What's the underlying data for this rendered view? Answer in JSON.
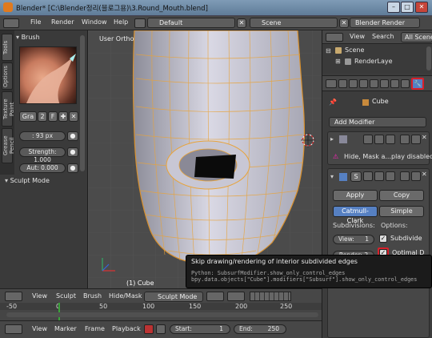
{
  "window": {
    "title": "Blender* [C:\\Blender정리(블로그용)\\3.Round_Mouth.blend]",
    "minimize": "–",
    "maximize": "□",
    "close": "✕"
  },
  "menu": {
    "items": [
      "File",
      "Render",
      "Window",
      "Help"
    ],
    "layout": "Default",
    "scene": "Scene",
    "engine": "Blender Render"
  },
  "tool_panel": {
    "tabs": [
      "Tools",
      "Options",
      "Texture Paint",
      "Grease Pencil"
    ],
    "brush_header": "Brush",
    "brush_name": "Gra",
    "brush_users": "2",
    "brush_fake": "F",
    "radius": ": 93 px",
    "strength": "Strength: 1.000",
    "autosmooth": "Aut: 0.000",
    "sculpt_mode_header": "Sculpt Mode"
  },
  "viewport": {
    "view_label": "User Ortho",
    "object_label": "(1) Cube"
  },
  "outliner": {
    "menu_view": "View",
    "menu_search": "Search",
    "filter": "All Scene",
    "items": [
      "Scene",
      "RenderLaye"
    ]
  },
  "properties": {
    "object_name": "Cube",
    "add_modifier": "Add Modifier",
    "hide_mask_label": "Hide, Mask a...play disabled",
    "modifier_short": "S",
    "apply": "Apply",
    "copy": "Copy",
    "catmull": "Catmull-Clark",
    "simple": "Simple",
    "subdivisions_label": "Subdivisions:",
    "options_label": "Options:",
    "view_field": "View:",
    "view_value": "1",
    "render_field": "Render: 2",
    "subdivide_uv": "Subdivide",
    "optimal": "Optimal D"
  },
  "tooltip": {
    "title": "Skip drawing/rendering of interior subdivided edges",
    "python1": "Python: SubsurfModifier.show_only_control_edges",
    "python2": "bpy.data.objects[\"Cube\"].modifiers[\"Subsurf\"].show_only_control_edges"
  },
  "viewport_header": {
    "view": "View",
    "sculpt": "Sculpt",
    "brush": "Brush",
    "hide_mask": "Hide/Mask",
    "mode": "Sculpt Mode"
  },
  "timeline": {
    "ticks": [
      "-50",
      "0",
      "50",
      "100",
      "150",
      "200",
      "250"
    ]
  },
  "timeline_header": {
    "view": "View",
    "marker": "Marker",
    "frame": "Frame",
    "playback": "Playback",
    "start": "Start:",
    "start_value": "1",
    "end": "End:",
    "end_value": "250"
  },
  "colors": {
    "accent_blue": "#5680c2",
    "highlight_red": "#d8202a",
    "wire_orange": "#e8a33a"
  }
}
